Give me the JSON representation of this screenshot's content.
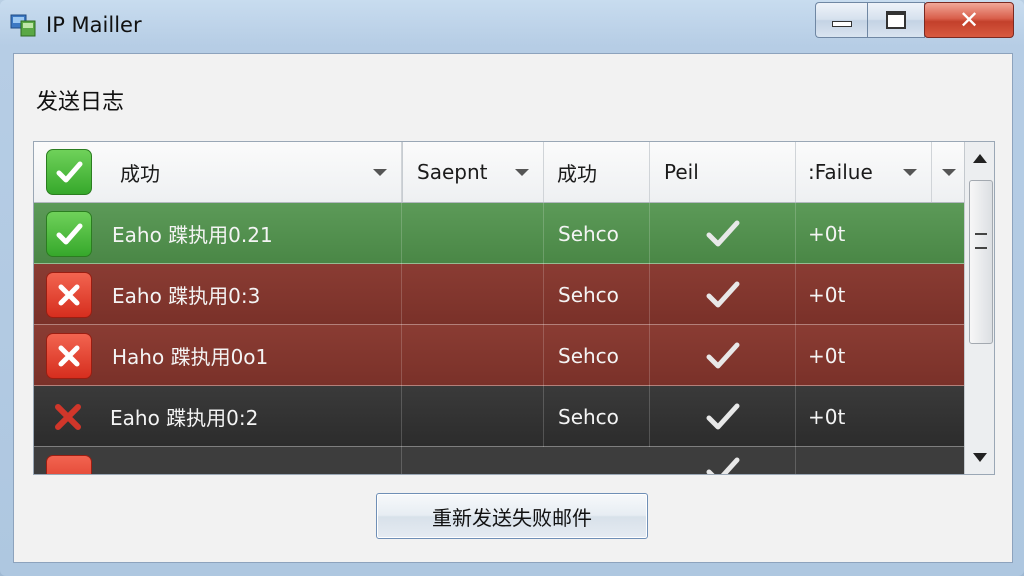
{
  "window": {
    "title": "IP Mailler"
  },
  "caption_buttons": {
    "minimize": "minimize",
    "maximize": "maximize",
    "close": "✕"
  },
  "section": {
    "title": "发送日志"
  },
  "columns": [
    {
      "label": "成功"
    },
    {
      "label": "Saepnt"
    },
    {
      "label": "成功"
    },
    {
      "label": "Peil"
    },
    {
      "label": ":Failue"
    }
  ],
  "rows": [
    {
      "status": "success",
      "name": "Eaho 蹀执用0.21",
      "col3": "Sehco",
      "check": true,
      "failure": "+0t"
    },
    {
      "status": "fail",
      "name": "Eaho 蹀执用0:3",
      "col3": "Sehco",
      "check": true,
      "failure": "+0t"
    },
    {
      "status": "fail",
      "name": "Haho 蹀执用0o1",
      "col3": "Sehco",
      "check": true,
      "failure": "+0t"
    },
    {
      "status": "fail",
      "name": "Eaho 蹀执用0:2",
      "col3": "Sehco",
      "check": true,
      "failure": "+0t"
    }
  ],
  "buttons": {
    "resend": "重新发送失败邮件"
  },
  "colors": {
    "success_row": "#4f8b4b",
    "fail_row": "#7e332b",
    "dark_row": "#333333"
  }
}
